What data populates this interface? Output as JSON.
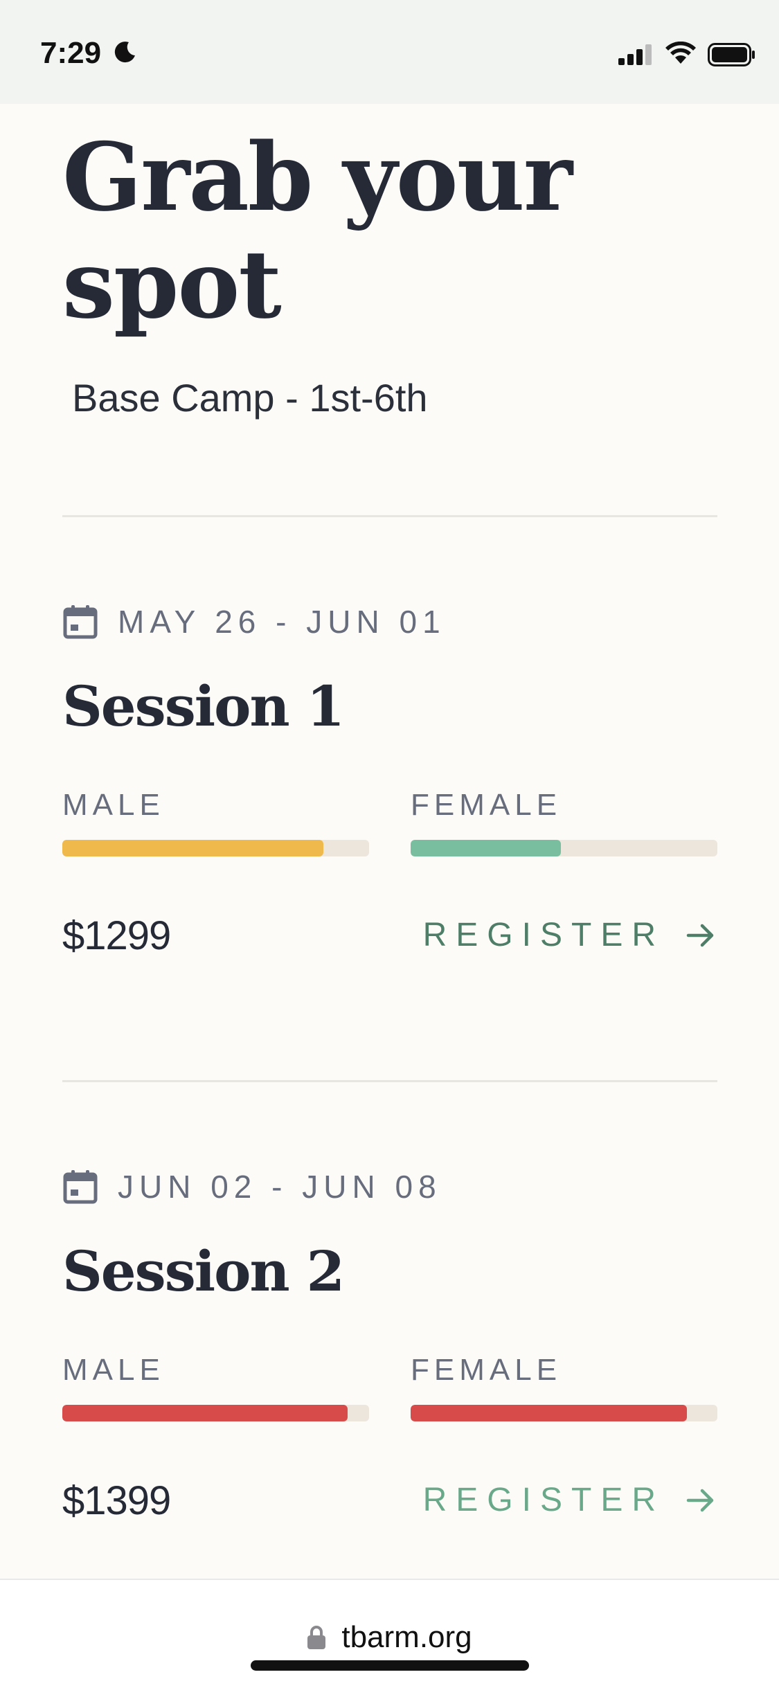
{
  "status_bar": {
    "time": "7:29"
  },
  "hero": {
    "title": "Grab your spot",
    "subtitle": "Base Camp - 1st-6th"
  },
  "sessions": [
    {
      "dates": "MAY 26 - JUN 01",
      "title": "Session 1",
      "male_label": "MALE",
      "female_label": "FEMALE",
      "male_fill": 0.85,
      "female_fill": 0.49,
      "male_color": "#f0b94c",
      "female_color": "#79bf9f",
      "price": "$1299",
      "register_label": "REGISTER",
      "register_color": "#4e7e68"
    },
    {
      "dates": "JUN 02 - JUN 08",
      "title": "Session 2",
      "male_label": "MALE",
      "female_label": "FEMALE",
      "male_fill": 0.93,
      "female_fill": 0.9,
      "male_color": "#d74c4a",
      "female_color": "#d74c4a",
      "price": "$1399",
      "register_label": "REGISTER",
      "register_color": "#6aa88a"
    }
  ],
  "browser": {
    "url": "tbarm.org"
  },
  "colors": {
    "background": "#fcfbf7",
    "text": "#252a36",
    "muted": "#676d7c",
    "track": "#ece6dc"
  },
  "icons": [
    "moon-icon",
    "signal-icon",
    "wifi-icon",
    "battery-icon",
    "calendar-icon",
    "arrow-right-icon",
    "lock-icon"
  ]
}
